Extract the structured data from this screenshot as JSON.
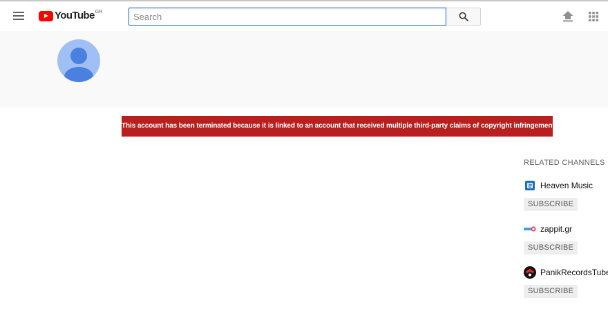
{
  "masthead": {
    "logo_text": "YouTube",
    "country_code": "GR",
    "search": {
      "placeholder": "Search",
      "value": ""
    }
  },
  "alert": {
    "message": "This account has been terminated because it is linked to an account that received multiple third-party claims of copyright infringement.",
    "background": "#b91f1f"
  },
  "related_channels": {
    "title": "RELATED CHANNELS",
    "items": [
      {
        "name": "Heaven Music",
        "icon": "heaven-music-thumbnail",
        "subscribe_label": "SUBSCRIBE"
      },
      {
        "name": "zappit.gr",
        "icon": "zappit-thumbnail",
        "subscribe_label": "SUBSCRIBE"
      },
      {
        "name": "PanikRecordsTube",
        "icon": "panik-records-thumbnail",
        "subscribe_label": "SUBSCRIBE"
      }
    ]
  },
  "colors": {
    "brand_red": "#ff0000",
    "alert_red": "#b91f1f",
    "search_focus_border": "#1c62b9",
    "avatar_bg": "#a0c0f5",
    "avatar_fg": "#4a80e0",
    "header_bg": "#f9f9f9"
  }
}
